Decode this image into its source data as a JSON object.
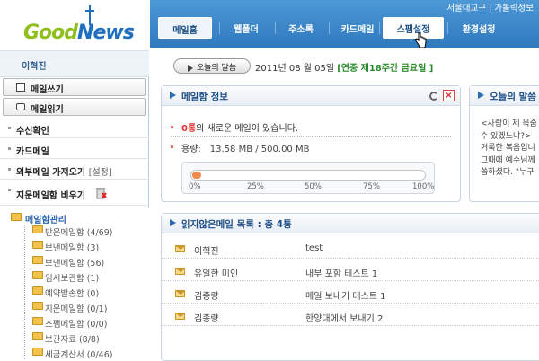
{
  "app": {
    "logo_text_green": "Good",
    "logo_text_blue": "News"
  },
  "header": {
    "links": [
      "서울대교구",
      "가톨릭정보"
    ],
    "link_separator": "|",
    "tabs": [
      {
        "label": "메일홈",
        "state": "active"
      },
      {
        "label": "웹폴더",
        "state": "normal"
      },
      {
        "label": "주소록",
        "state": "normal"
      },
      {
        "label": "카드메일",
        "state": "normal"
      },
      {
        "label": "스팸설정",
        "state": "hover"
      },
      {
        "label": "환경설정",
        "state": "normal"
      }
    ]
  },
  "sidebar": {
    "user_name": "이혁진",
    "write_button": "메일쓰기",
    "read_button": "메일읽기",
    "menu": [
      {
        "label": "수신확인",
        "sub": ""
      },
      {
        "label": "카드메일",
        "sub": ""
      },
      {
        "label": "외부메일 가져오기",
        "sub": "[설정]"
      },
      {
        "label": "지운메일함 비우기",
        "sub": ""
      }
    ],
    "folder_header": "메일함관리",
    "folders": [
      "받은메일함 (4/69)",
      "보낸메일함 (3)",
      "보낸메일함 (56)",
      "임시보관함 (1)",
      "예약발송함 (0)",
      "지운메일함 (0/1)",
      "스팸메일함 (0/0)",
      "보관자료 (8/8)",
      "세금계산서 (0/46)"
    ]
  },
  "quote_bar": {
    "button_label": "오늘의 말씀",
    "date_text": "2011년 08 월 05일",
    "liturgy_text": "[연중 제18주간 금요일 ]"
  },
  "mail_info": {
    "title": "메일함 정보",
    "new_count": "0통",
    "new_text": "의 새로운 메일이 있습니다.",
    "usage_label": "용량:",
    "usage_value": "13.58 MB / 500.00 MB",
    "usage_fraction": 0.027,
    "usage_ticks": [
      "0%",
      "25%",
      "50%",
      "75%",
      "100%"
    ],
    "accent_color": "#f08a4b"
  },
  "quote_panel": {
    "title": "오늘의 말씀",
    "lines": [
      "<사람이 제 목숨",
      "수 있겠느냐?>",
      "거룩한 복음입니",
      "그때에 예수님께",
      "씀하셨다. \"누구"
    ]
  },
  "unread": {
    "title": "읽지않은메일 목록 : 총 4통",
    "rows": [
      {
        "from": "이혁진",
        "subject": "test"
      },
      {
        "from": "유일한 미인",
        "subject": "내부 포함 테스트 1"
      },
      {
        "from": "김종량",
        "subject": "메일 보내기 테스트 1"
      },
      {
        "from": "김종량",
        "subject": "한양대에서 보내기 2"
      }
    ]
  }
}
